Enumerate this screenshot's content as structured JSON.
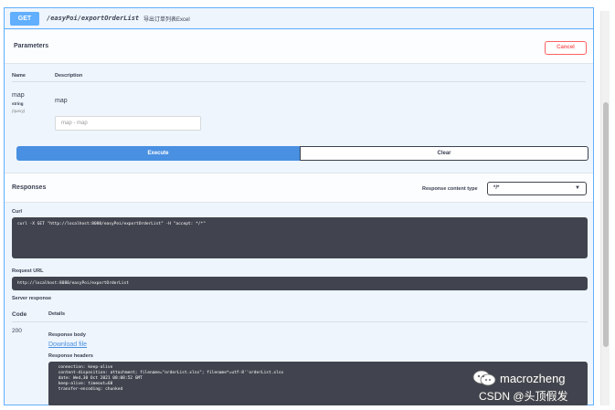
{
  "operation": {
    "method": "GET",
    "path": "/easyPoi/exportOrderList",
    "summary": "导出订单列表Excel"
  },
  "parameters": {
    "title": "Parameters",
    "cancel_label": "Cancel",
    "col_name": "Name",
    "col_description": "Description",
    "param": {
      "name": "map",
      "type": "string",
      "location": "(query)",
      "description": "map",
      "placeholder": "map - map"
    }
  },
  "actions": {
    "execute_label": "Execute",
    "clear_label": "Clear"
  },
  "responses": {
    "title": "Responses",
    "content_type_label": "Response content type",
    "content_type_value": "*/*",
    "curl_label": "Curl",
    "curl_value": "curl -X GET \"http://localhost:8080/easyPoi/exportOrderList\" -H \"accept: */*\"",
    "request_url_label": "Request URL",
    "request_url_value": "http://localhost:8080/easyPoi/exportOrderList",
    "server_response_label": "Server response",
    "code_label": "Code",
    "details_label": "Details",
    "code_value": "200",
    "body_label": "Response body",
    "download_label": "Download file",
    "headers_label": "Response headers",
    "headers_value": " connection: keep-alive\n content-disposition: attachment; filename=\"orderList.xlsx\"; filename*=utf-8''orderList.xlsx\n date: Wed,30 Oct 2021 08:08:52 GMT\n keep-alive: timeout=60\n transfer-encoding: chunked"
  },
  "watermark": {
    "brand": "macrozheng",
    "csdn": "CSDN @头顶假发"
  }
}
